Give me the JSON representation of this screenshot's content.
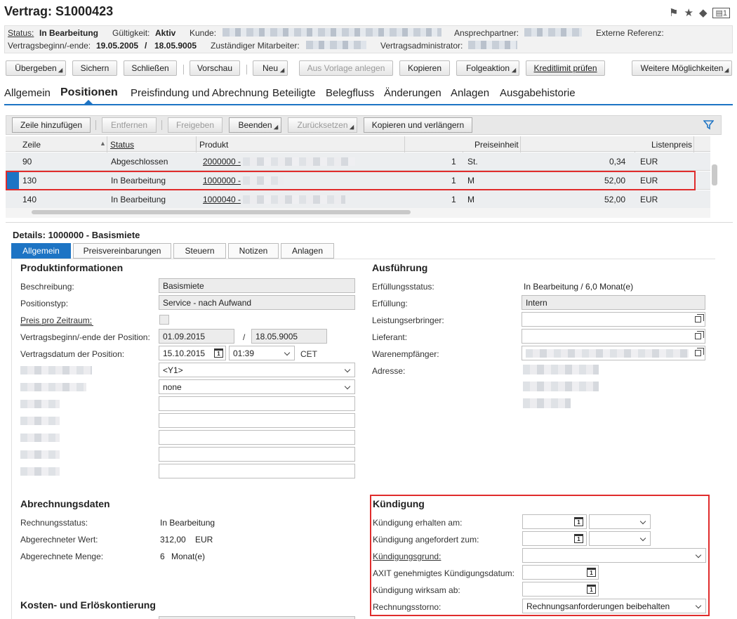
{
  "header": {
    "title": "Vertrag: S1000423",
    "status_label": "Status:",
    "status_value": "In Bearbeitung",
    "validity_label": "Gültigkeit:",
    "validity_value": "Aktiv",
    "customer_label": "Kunde:",
    "contact_label": "Ansprechpartner:",
    "extref_label": "Externe Referenz:",
    "dates_label": "Vertragsbeginn/-ende:",
    "start_date": "19.05.2005",
    "date_sep": "/",
    "end_date": "18.05.9005",
    "employee_label": "Zuständiger Mitarbeiter:",
    "admin_label": "Vertragsadministrator:"
  },
  "toolbar": {
    "uebergeben": "Übergeben",
    "sichern": "Sichern",
    "schliessen": "Schließen",
    "vorschau": "Vorschau",
    "neu": "Neu",
    "vorlage": "Aus Vorlage anlegen",
    "kopieren": "Kopieren",
    "folgeaktion": "Folgeaktion",
    "kreditlimit": "Kreditlimit prüfen",
    "weitere": "Weitere Möglichkeiten"
  },
  "tabs": [
    "Allgemein",
    "Positionen",
    "Preisfindung und Abrechnung",
    "Beteiligte",
    "Belegfluss",
    "Änderungen",
    "Anlagen",
    "Ausgabehistorie"
  ],
  "grid": {
    "buttons": {
      "add": "Zeile hinzufügen",
      "remove": "Entfernen",
      "release": "Freigeben",
      "finish": "Beenden",
      "reset": "Zurücksetzen",
      "copy_extend": "Kopieren und verlängern"
    },
    "columns": {
      "zeile": "Zeile",
      "status": "Status",
      "produkt": "Produkt",
      "preiseinheit": "Preiseinheit",
      "listenpreis": "Listenpreis"
    },
    "rows": [
      {
        "zeile": "90",
        "status": "Abgeschlossen",
        "produkt": "2000000 -",
        "qty": "1",
        "unit": "St.",
        "price": "0,34",
        "currency": "EUR"
      },
      {
        "zeile": "130",
        "status": "In Bearbeitung",
        "produkt": "1000000 -",
        "qty": "1",
        "unit": "M",
        "price": "52,00",
        "currency": "EUR"
      },
      {
        "zeile": "140",
        "status": "In Bearbeitung",
        "produkt": "1000040 -",
        "qty": "1",
        "unit": "M",
        "price": "52,00",
        "currency": "EUR"
      }
    ]
  },
  "details": {
    "title": "Details:  1000000 - Basismiete",
    "tabs": [
      "Allgemein",
      "Preisvereinbarungen",
      "Steuern",
      "Notizen",
      "Anlagen"
    ],
    "produkt": {
      "heading": "Produktinformationen",
      "beschreibung_label": "Beschreibung:",
      "beschreibung_value": "Basismiete",
      "positionstyp_label": "Positionstyp:",
      "positionstyp_value": "Service - nach Aufwand",
      "preis_label": "Preis pro Zeitraum:",
      "beginn_label": "Vertragsbeginn/-ende der Position:",
      "beginn_value": "01.09.2015",
      "ende_sep": "/",
      "ende_value": "18.05.9005",
      "datum_label": "Vertragsdatum der Position:",
      "datum_value": "15.10.2015",
      "zeit_value": "01:39",
      "tz_value": "CET",
      "select1_value": "<Y1>",
      "select2_value": "none"
    },
    "ausfuehrung": {
      "heading": "Ausführung",
      "status_label": "Erfüllungsstatus:",
      "status_value": "In Bearbeitung / 6,0 Monat(e)",
      "erfuellung_label": "Erfüllung:",
      "erfuellung_value": "Intern",
      "leistung_label": "Leistungserbringer:",
      "lieferant_label": "Lieferant:",
      "waren_label": "Warenempfänger:",
      "adresse_label": "Adresse:"
    },
    "abrechnung": {
      "heading": "Abrechnungsdaten",
      "status_label": "Rechnungsstatus:",
      "status_value": "In Bearbeitung",
      "wert_label": "Abgerechneter Wert:",
      "wert_value": "312,00",
      "wert_currency": "EUR",
      "menge_label": "Abgerechnete Menge:",
      "menge_value": "6",
      "menge_unit": "Monat(e)"
    },
    "kosten": {
      "heading": "Kosten- und Erlöskontierung"
    },
    "kuendigung": {
      "heading": "Kündigung",
      "erhalten_label": "Kündigung erhalten am:",
      "angefordert_label": "Kündigung angefordert zum:",
      "grund_label": "Kündigungsgrund:",
      "axit_label": "AXIT genehmigtes Kündigungsdatum:",
      "wirksam_label": "Kündigung wirksam ab:",
      "storno_label": "Rechnungsstorno:",
      "storno_value": "Rechnungsanforderungen beibehalten"
    }
  }
}
